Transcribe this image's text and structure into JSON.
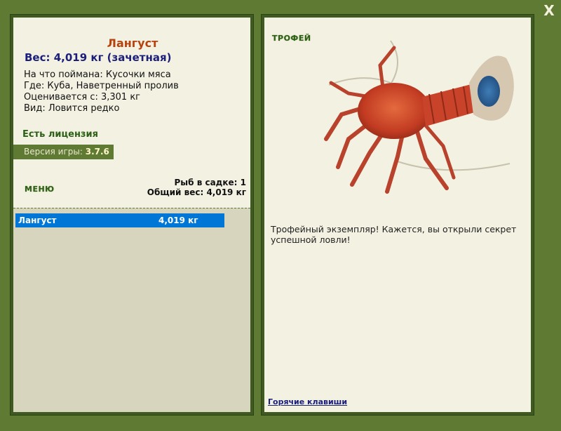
{
  "window": {
    "close_label": "X"
  },
  "fish": {
    "name": "Лангуст",
    "weight_line": "Вес: 4,019 кг (зачетная)",
    "caught_on": "На что поймана: Кусочки мяса",
    "location": "Где: Куба, Наветренный пролив",
    "valued_from": "Оценивается с: 3,301 кг",
    "species_note": "Вид: Ловится редко"
  },
  "license": "Есть лицензия",
  "version": {
    "label": "Версия игры:",
    "value": "3.7.6"
  },
  "menu": {
    "label": "МЕНЮ"
  },
  "keep": {
    "fish_count": "Рыб в садке: 1",
    "total_weight": "Общий вес: 4,019 кг",
    "items": [
      {
        "name": "Лангуст",
        "weight": "4,019 кг"
      }
    ]
  },
  "trophy": {
    "label": "ТРОФЕЙ",
    "text": "Трофейный экземпляр! Кажется, вы открыли секрет успешной ловли!"
  },
  "hotkeys_link": "Горячие клавиши",
  "colors": {
    "frame": "#5f7a32",
    "panel_bg": "#f3f1e2",
    "title": "#b7420d",
    "weight": "#1b1f7a",
    "license": "#2d6017",
    "selection": "#0077d6"
  },
  "icons": {
    "close": "close-icon",
    "fish_picture": "lobster-picture"
  }
}
